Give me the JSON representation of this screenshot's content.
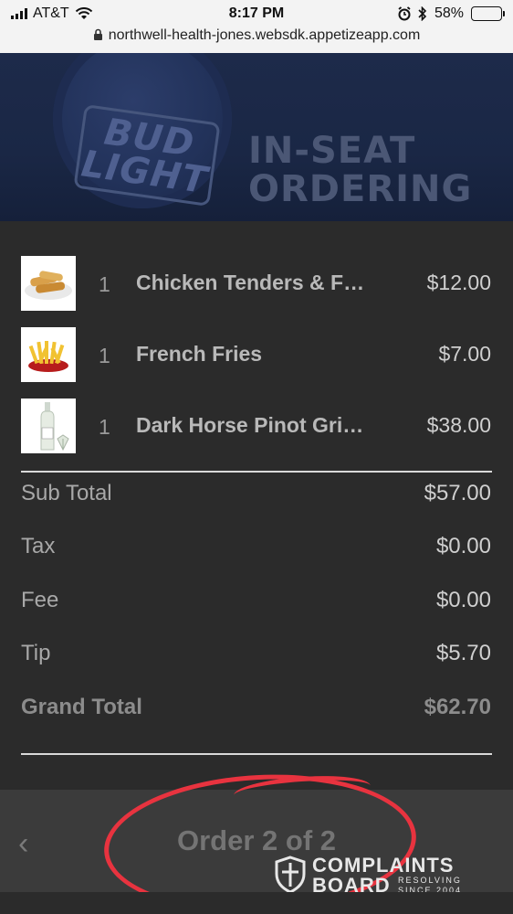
{
  "status_bar": {
    "carrier": "AT&T",
    "time": "8:17 PM",
    "battery": "58%",
    "battery_level": 0.58,
    "url": "northwell-health-jones.websdk.appetizeapp.com"
  },
  "banner": {
    "logo_text": "BUD LIGHT",
    "title_line1": "IN-SEAT",
    "title_line2": "ORDERING"
  },
  "items": [
    {
      "qty": "1",
      "name": "Chicken Tenders & F…",
      "price": "$12.00",
      "icon": "chicken-tenders-thumbnail"
    },
    {
      "qty": "1",
      "name": "French Fries",
      "price": "$7.00",
      "icon": "french-fries-thumbnail"
    },
    {
      "qty": "1",
      "name": "Dark Horse Pinot Gri…",
      "price": "$38.00",
      "icon": "wine-bottle-thumbnail"
    }
  ],
  "totals": {
    "sub_total_label": "Sub Total",
    "sub_total": "$57.00",
    "tax_label": "Tax",
    "tax": "$0.00",
    "fee_label": "Fee",
    "fee": "$0.00",
    "tip_label": "Tip",
    "tip": "$5.70",
    "grand_total_label": "Grand Total",
    "grand_total": "$62.70"
  },
  "footer": {
    "back_glyph": "‹",
    "order_label": "Order 2 of 2"
  },
  "watermark": {
    "line1": "COMPLAINTS",
    "line2": "BOARD",
    "tagline": "RESOLVING SINCE 2004"
  },
  "colors": {
    "background": "#2b2b2b",
    "footer": "#3b3b3b",
    "annotation_circle": "#e8333f"
  }
}
